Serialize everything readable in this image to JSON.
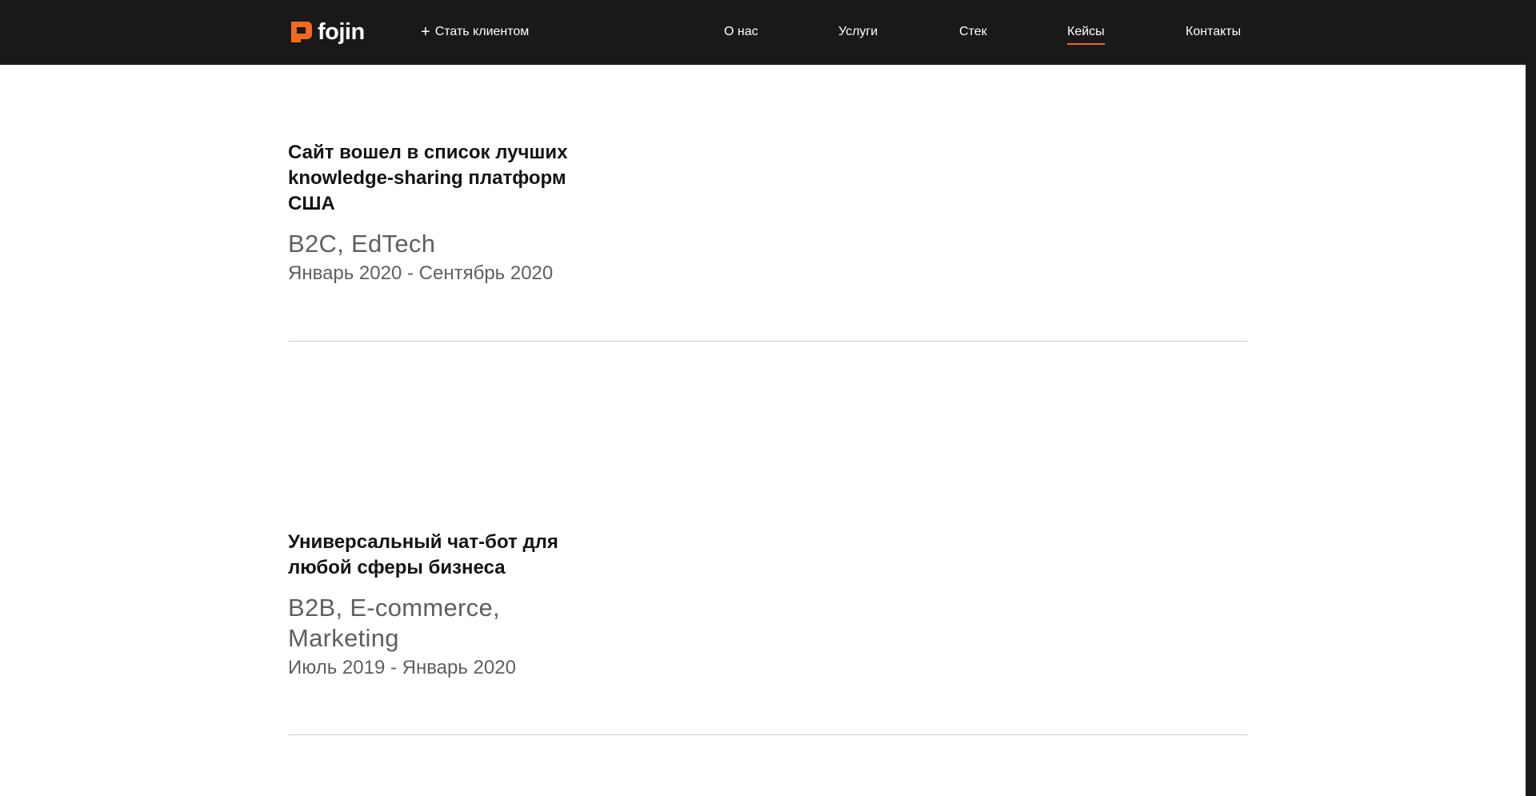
{
  "header": {
    "logo_text": "fojin",
    "become_client_label": "Стать клиентом",
    "become_client_icon": "plus-icon",
    "accent_color": "#f56a1b",
    "nav": [
      {
        "label": "О нас"
      },
      {
        "label": "Услуги"
      },
      {
        "label": "Стек"
      },
      {
        "label": "Кейсы",
        "active": true
      },
      {
        "label": "Контакты"
      }
    ]
  },
  "cases": [
    {
      "title": "Сайт вошел в список лучших knowledge-sharing платформ США",
      "tags": "B2C, EdTech",
      "dates": "Январь 2020 - Сентябрь 2020"
    },
    {
      "title": "Универсальный чат-бот для любой сферы бизнеса",
      "tags": "B2B, E-commerce, Marketing",
      "dates": "Июль 2019 - Январь 2020"
    }
  ]
}
